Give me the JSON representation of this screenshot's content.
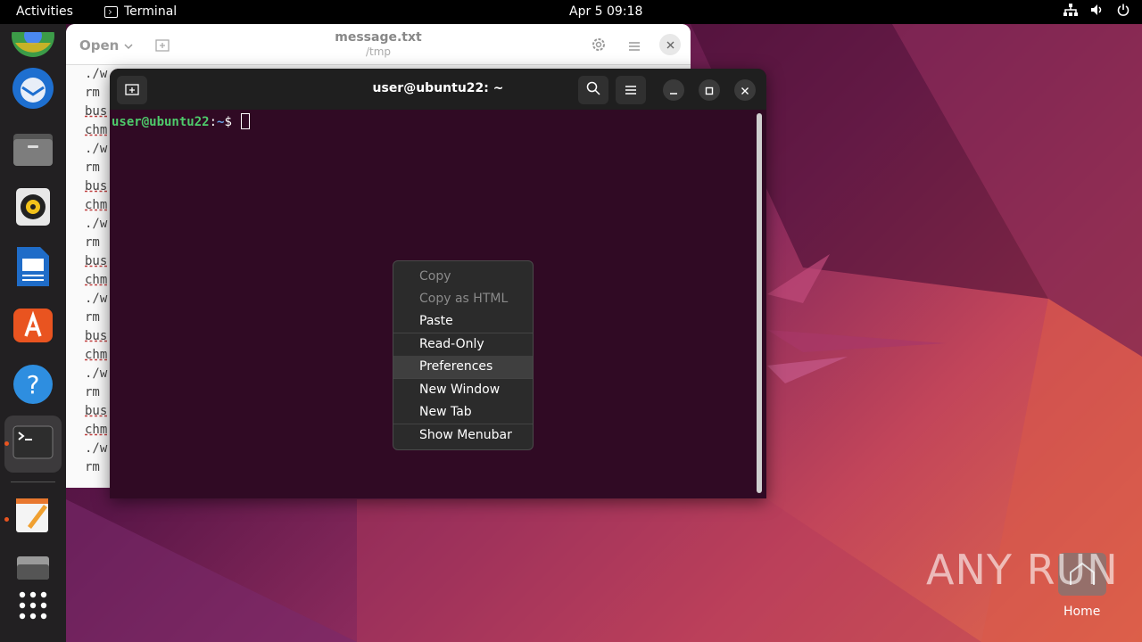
{
  "topbar": {
    "activities": "Activities",
    "app_name": "Terminal",
    "clock": "Apr 5  09:18"
  },
  "dock": {
    "items": [
      {
        "name": "chrome",
        "icon": "chrome-icon"
      },
      {
        "name": "thunderbird",
        "icon": "thunderbird-icon"
      },
      {
        "name": "files",
        "icon": "files-icon"
      },
      {
        "name": "rhythmbox",
        "icon": "rhythmbox-icon"
      },
      {
        "name": "libreoffice-writer",
        "icon": "writer-icon"
      },
      {
        "name": "app-center",
        "icon": "app-center-icon"
      },
      {
        "name": "help",
        "icon": "help-icon"
      },
      {
        "name": "terminal",
        "icon": "terminal-icon"
      },
      {
        "name": "text-editor",
        "icon": "text-editor-icon"
      },
      {
        "name": "disk",
        "icon": "disk-icon"
      },
      {
        "name": "show-apps",
        "icon": "grid-icon"
      }
    ]
  },
  "gedit": {
    "open_label": "Open",
    "title": "message.txt",
    "subtitle": "/tmp",
    "lines": [
      "./w",
      "rm",
      "bus",
      "chm",
      "./w",
      "rm",
      "bus",
      "chm",
      "./w",
      "rm",
      "bus",
      "chm",
      "./w",
      "rm",
      "bus",
      "chm",
      "./w",
      "rm",
      "bus",
      "chm",
      "./w",
      "rm"
    ]
  },
  "terminal": {
    "title": "user@ubuntu22: ~",
    "prompt_user": "user@ubuntu22",
    "prompt_colon": ":",
    "prompt_path": "~",
    "prompt_symbol": "$"
  },
  "context_menu": {
    "items": [
      {
        "label": "Copy",
        "enabled": false
      },
      {
        "label": "Copy as HTML",
        "enabled": false
      },
      {
        "label": "Paste",
        "enabled": true
      },
      {
        "label": "Read-Only",
        "enabled": true
      },
      {
        "label": "Preferences",
        "enabled": true
      },
      {
        "label": "New Window",
        "enabled": true
      },
      {
        "label": "New Tab",
        "enabled": true
      },
      {
        "label": "Show Menubar",
        "enabled": true
      }
    ]
  },
  "desktop": {
    "watermark": "ANY RUN",
    "home_label": "Home"
  },
  "colors": {
    "terminal_bg": "#300a24",
    "prompt_user": "#4ecb6b",
    "prompt_path": "#6aa3e8",
    "accent": "#e95420"
  }
}
